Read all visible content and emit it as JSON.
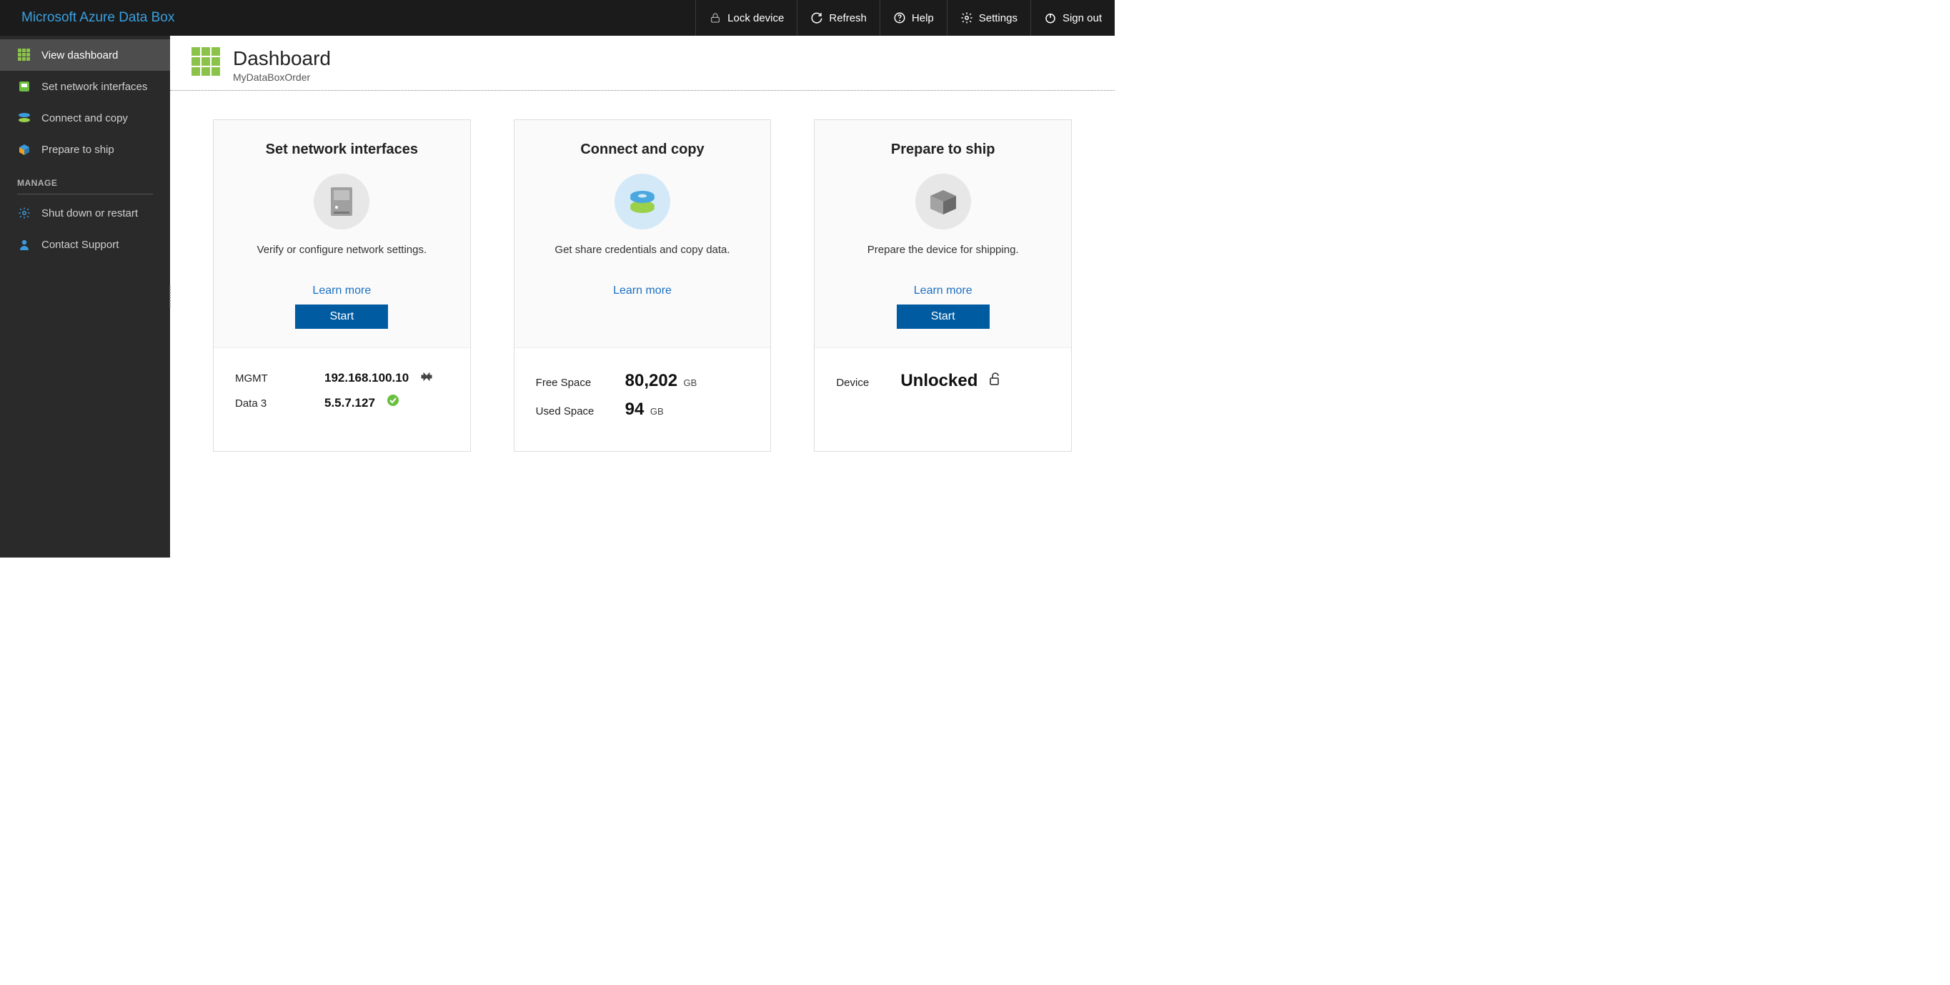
{
  "brand": "Microsoft Azure Data Box",
  "topbar": {
    "lock": "Lock device",
    "refresh": "Refresh",
    "help": "Help",
    "settings": "Settings",
    "signout": "Sign out"
  },
  "sidebar": {
    "view_dashboard": "View dashboard",
    "set_network": "Set network interfaces",
    "connect_copy": "Connect and copy",
    "prepare_ship": "Prepare to ship",
    "manage_heading": "MANAGE",
    "shutdown": "Shut down or restart",
    "contact": "Contact Support"
  },
  "header": {
    "title": "Dashboard",
    "subtitle": "MyDataBoxOrder"
  },
  "cards": {
    "network": {
      "title": "Set network interfaces",
      "desc": "Verify or configure network settings.",
      "learn": "Learn more",
      "start": "Start",
      "rows": [
        {
          "label": "MGMT",
          "value": "192.168.100.10"
        },
        {
          "label": "Data 3",
          "value": "5.5.7.127"
        }
      ]
    },
    "connect": {
      "title": "Connect and copy",
      "desc": "Get share credentials and copy data.",
      "learn": "Learn more",
      "free_label": "Free Space",
      "free_value": "80,202",
      "free_unit": "GB",
      "used_label": "Used Space",
      "used_value": "94",
      "used_unit": "GB"
    },
    "ship": {
      "title": "Prepare to ship",
      "desc": "Prepare the device for shipping.",
      "learn": "Learn more",
      "start": "Start",
      "device_label": "Device",
      "device_value": "Unlocked"
    }
  }
}
